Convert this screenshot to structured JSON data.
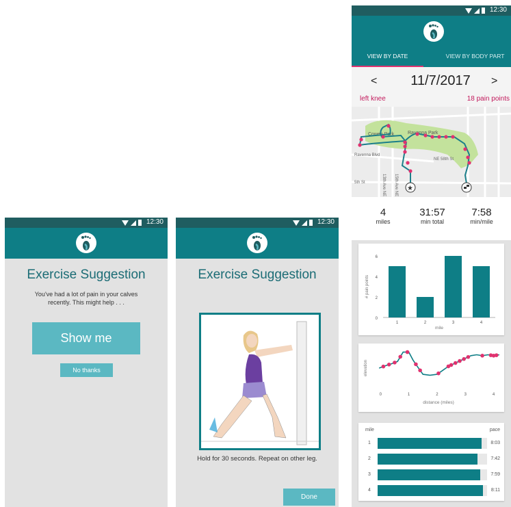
{
  "status_time": "12:30",
  "phone1": {
    "title": "Exercise Suggestion",
    "message": "You've had a lot of pain in your calves recently. This might help . . .",
    "show_me_label": "Show me",
    "no_thanks_label": "No thanks"
  },
  "phone2": {
    "title": "Exercise Suggestion",
    "instruction": "Hold for 30 seconds. Repeat on other leg.",
    "done_label": "Done"
  },
  "phone3": {
    "tabs": [
      "VIEW BY DATE",
      "VIEW BY BODY PART"
    ],
    "active_tab": "VIEW BY DATE",
    "prev_label": "<",
    "next_label": ">",
    "date": "11/7/2017",
    "body_part": "left knee",
    "pain_points": "18 pain points",
    "map_labels": {
      "park1": "Cowen Park",
      "park2": "Ravenna Park",
      "street1": "Ravenna Blvd",
      "street2": "NE 58th St",
      "street3": "5th St",
      "street4": "13th Ave NE",
      "street5": "15th Ave NE"
    },
    "stats": [
      {
        "value": "4",
        "unit": "miles"
      },
      {
        "value": "31:57",
        "unit": "min total"
      },
      {
        "value": "7:58",
        "unit": "min/mile"
      }
    ],
    "pace_header_left": "mile",
    "pace_header_right": "pace",
    "pace_rows": [
      {
        "mile": "1",
        "pace": "8:03",
        "fraction": 0.95
      },
      {
        "mile": "2",
        "pace": "7:42",
        "fraction": 0.91
      },
      {
        "mile": "3",
        "pace": "7:59",
        "fraction": 0.94
      },
      {
        "mile": "4",
        "pace": "8:11",
        "fraction": 0.96
      }
    ]
  },
  "colors": {
    "teal": "#0e7e86",
    "dark_teal": "#1f5d60",
    "button": "#5bb8c2",
    "pink": "#e0326f",
    "crimson": "#c2185b",
    "park_green": "#c3e29c"
  },
  "chart_data": [
    {
      "type": "bar",
      "categories": [
        "1",
        "2",
        "3",
        "4"
      ],
      "values": [
        5,
        2,
        6,
        5
      ],
      "xlabel": "mile",
      "ylabel": "# pain points",
      "ylim": [
        0,
        6
      ],
      "yticks": [
        "0",
        "2",
        "4",
        "6"
      ]
    },
    {
      "type": "line",
      "xlabel": "distance (miles)",
      "ylabel": "elevation",
      "xlim": [
        -0.2,
        4.3
      ],
      "xticks": [
        "0",
        "1",
        "2",
        "3",
        "4"
      ],
      "series": [
        {
          "x": [
            -0.05,
            0.2,
            0.4,
            0.6,
            0.8,
            1.0,
            1.15,
            1.3,
            1.5,
            1.75,
            2.0,
            2.2,
            2.4,
            2.6,
            2.8,
            3.0,
            3.2,
            3.4,
            3.6,
            3.8,
            4.0,
            4.2
          ],
          "y": [
            40,
            46,
            50,
            55,
            76,
            76,
            58,
            44,
            26,
            24,
            26,
            35,
            44,
            50,
            56,
            62,
            68,
            70,
            68,
            70,
            68,
            70
          ]
        }
      ],
      "pain_marker_x": [
        0.1,
        0.3,
        0.5,
        0.7,
        0.95,
        1.25,
        1.4,
        2.05,
        2.4,
        2.5,
        2.65,
        2.8,
        2.95,
        3.1,
        3.6,
        3.9,
        4.0,
        4.1
      ]
    }
  ]
}
